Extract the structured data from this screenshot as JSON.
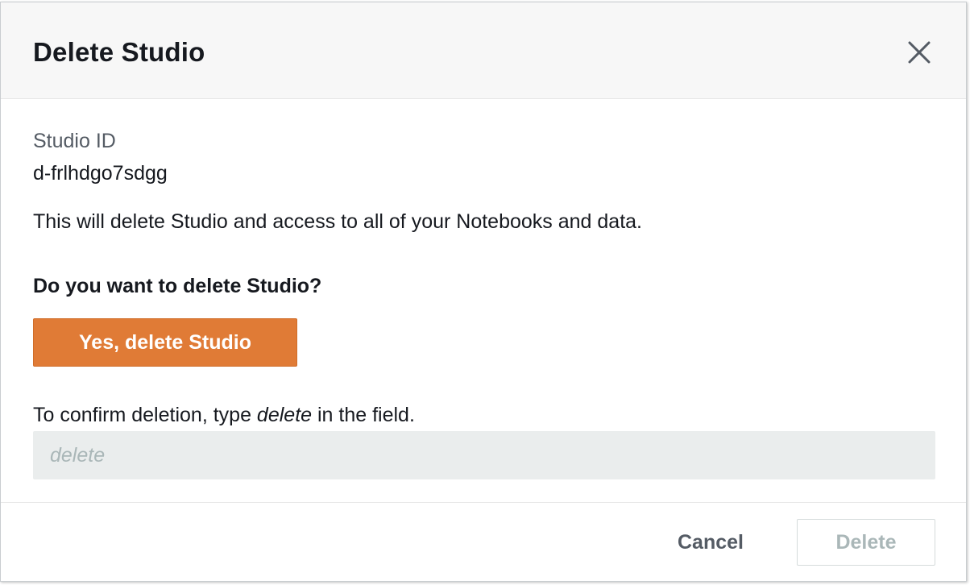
{
  "modal": {
    "title": "Delete Studio",
    "close_icon": "close-icon"
  },
  "body": {
    "studio_id_label": "Studio ID",
    "studio_id_value": "d-frlhdgo7sdgg",
    "warning": "This will delete Studio and access to all of your Notebooks and data.",
    "question": "Do you want to delete Studio?",
    "yes_button_label": "Yes, delete Studio",
    "confirm_prefix": "To confirm deletion, type ",
    "confirm_keyword": "delete",
    "confirm_suffix": " in the field.",
    "input_value": "",
    "input_placeholder": "delete"
  },
  "footer": {
    "cancel_label": "Cancel",
    "delete_label": "Delete",
    "delete_disabled": true
  },
  "colors": {
    "primary_orange": "#e07b36",
    "header_bg": "#f7f7f7",
    "input_bg": "#eaeded",
    "disabled_text": "#aab7b8",
    "text_primary": "#16191f",
    "text_secondary": "#545b64"
  }
}
